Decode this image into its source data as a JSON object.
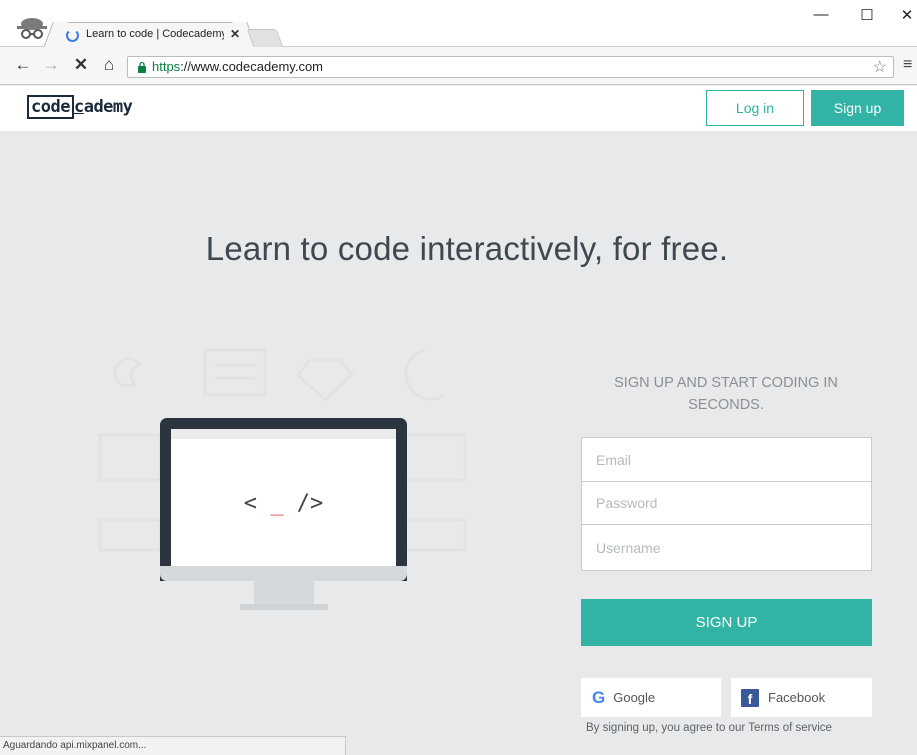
{
  "browser": {
    "tab_title": "Learn to code | Codecademy",
    "tab_close": "✕",
    "url_scheme": "https",
    "url_rest": "://www.codecademy.com",
    "status_text": "Aguardando api.mixpanel.com..."
  },
  "header": {
    "logo_boxed": "code",
    "logo_rest_first": "c",
    "logo_rest": "ademy",
    "login_label": "Log in",
    "signup_label": "Sign up"
  },
  "hero": {
    "title": "Learn to code interactively, for free."
  },
  "illustration": {
    "code_left": "< ",
    "code_cursor": "_",
    "code_right": " />"
  },
  "form": {
    "heading": "SIGN UP AND START CODING IN SECONDS.",
    "email_placeholder": "Email",
    "password_placeholder": "Password",
    "username_placeholder": "Username",
    "submit_label": "SIGN UP",
    "google_label": "Google",
    "facebook_label": "Facebook",
    "terms_prefix": "By signing up, you agree to our ",
    "terms_link": "Terms of service"
  },
  "colors": {
    "accent": "#33b3a6",
    "page_bg": "#e8e9ea",
    "monitor": "#2c3440",
    "cursor": "#e24e4e"
  }
}
